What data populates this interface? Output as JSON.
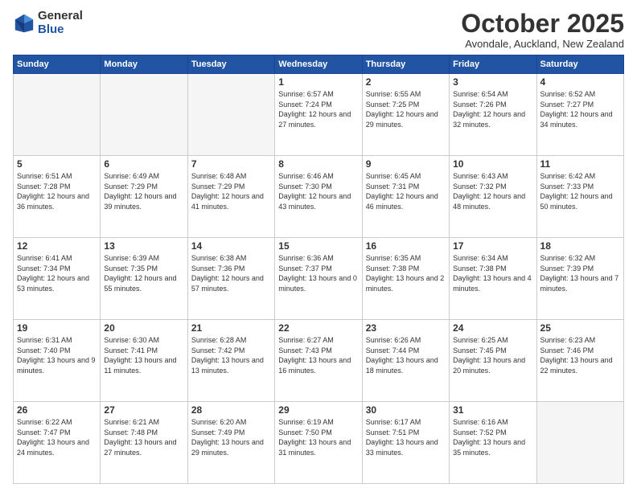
{
  "logo": {
    "general": "General",
    "blue": "Blue"
  },
  "header": {
    "month": "October 2025",
    "location": "Avondale, Auckland, New Zealand"
  },
  "weekdays": [
    "Sunday",
    "Monday",
    "Tuesday",
    "Wednesday",
    "Thursday",
    "Friday",
    "Saturday"
  ],
  "weeks": [
    [
      {
        "day": "",
        "empty": true
      },
      {
        "day": "",
        "empty": true
      },
      {
        "day": "",
        "empty": true
      },
      {
        "day": "1",
        "sunrise": "6:57 AM",
        "sunset": "7:24 PM",
        "daylight": "12 hours and 27 minutes."
      },
      {
        "day": "2",
        "sunrise": "6:55 AM",
        "sunset": "7:25 PM",
        "daylight": "12 hours and 29 minutes."
      },
      {
        "day": "3",
        "sunrise": "6:54 AM",
        "sunset": "7:26 PM",
        "daylight": "12 hours and 32 minutes."
      },
      {
        "day": "4",
        "sunrise": "6:52 AM",
        "sunset": "7:27 PM",
        "daylight": "12 hours and 34 minutes."
      }
    ],
    [
      {
        "day": "5",
        "sunrise": "6:51 AM",
        "sunset": "7:28 PM",
        "daylight": "12 hours and 36 minutes."
      },
      {
        "day": "6",
        "sunrise": "6:49 AM",
        "sunset": "7:29 PM",
        "daylight": "12 hours and 39 minutes."
      },
      {
        "day": "7",
        "sunrise": "6:48 AM",
        "sunset": "7:29 PM",
        "daylight": "12 hours and 41 minutes."
      },
      {
        "day": "8",
        "sunrise": "6:46 AM",
        "sunset": "7:30 PM",
        "daylight": "12 hours and 43 minutes."
      },
      {
        "day": "9",
        "sunrise": "6:45 AM",
        "sunset": "7:31 PM",
        "daylight": "12 hours and 46 minutes."
      },
      {
        "day": "10",
        "sunrise": "6:43 AM",
        "sunset": "7:32 PM",
        "daylight": "12 hours and 48 minutes."
      },
      {
        "day": "11",
        "sunrise": "6:42 AM",
        "sunset": "7:33 PM",
        "daylight": "12 hours and 50 minutes."
      }
    ],
    [
      {
        "day": "12",
        "sunrise": "6:41 AM",
        "sunset": "7:34 PM",
        "daylight": "12 hours and 53 minutes."
      },
      {
        "day": "13",
        "sunrise": "6:39 AM",
        "sunset": "7:35 PM",
        "daylight": "12 hours and 55 minutes."
      },
      {
        "day": "14",
        "sunrise": "6:38 AM",
        "sunset": "7:36 PM",
        "daylight": "12 hours and 57 minutes."
      },
      {
        "day": "15",
        "sunrise": "6:36 AM",
        "sunset": "7:37 PM",
        "daylight": "13 hours and 0 minutes."
      },
      {
        "day": "16",
        "sunrise": "6:35 AM",
        "sunset": "7:38 PM",
        "daylight": "13 hours and 2 minutes."
      },
      {
        "day": "17",
        "sunrise": "6:34 AM",
        "sunset": "7:38 PM",
        "daylight": "13 hours and 4 minutes."
      },
      {
        "day": "18",
        "sunrise": "6:32 AM",
        "sunset": "7:39 PM",
        "daylight": "13 hours and 7 minutes."
      }
    ],
    [
      {
        "day": "19",
        "sunrise": "6:31 AM",
        "sunset": "7:40 PM",
        "daylight": "13 hours and 9 minutes."
      },
      {
        "day": "20",
        "sunrise": "6:30 AM",
        "sunset": "7:41 PM",
        "daylight": "13 hours and 11 minutes."
      },
      {
        "day": "21",
        "sunrise": "6:28 AM",
        "sunset": "7:42 PM",
        "daylight": "13 hours and 13 minutes."
      },
      {
        "day": "22",
        "sunrise": "6:27 AM",
        "sunset": "7:43 PM",
        "daylight": "13 hours and 16 minutes."
      },
      {
        "day": "23",
        "sunrise": "6:26 AM",
        "sunset": "7:44 PM",
        "daylight": "13 hours and 18 minutes."
      },
      {
        "day": "24",
        "sunrise": "6:25 AM",
        "sunset": "7:45 PM",
        "daylight": "13 hours and 20 minutes."
      },
      {
        "day": "25",
        "sunrise": "6:23 AM",
        "sunset": "7:46 PM",
        "daylight": "13 hours and 22 minutes."
      }
    ],
    [
      {
        "day": "26",
        "sunrise": "6:22 AM",
        "sunset": "7:47 PM",
        "daylight": "13 hours and 24 minutes."
      },
      {
        "day": "27",
        "sunrise": "6:21 AM",
        "sunset": "7:48 PM",
        "daylight": "13 hours and 27 minutes."
      },
      {
        "day": "28",
        "sunrise": "6:20 AM",
        "sunset": "7:49 PM",
        "daylight": "13 hours and 29 minutes."
      },
      {
        "day": "29",
        "sunrise": "6:19 AM",
        "sunset": "7:50 PM",
        "daylight": "13 hours and 31 minutes."
      },
      {
        "day": "30",
        "sunrise": "6:17 AM",
        "sunset": "7:51 PM",
        "daylight": "13 hours and 33 minutes."
      },
      {
        "day": "31",
        "sunrise": "6:16 AM",
        "sunset": "7:52 PM",
        "daylight": "13 hours and 35 minutes."
      },
      {
        "day": "",
        "empty": true
      }
    ]
  ]
}
